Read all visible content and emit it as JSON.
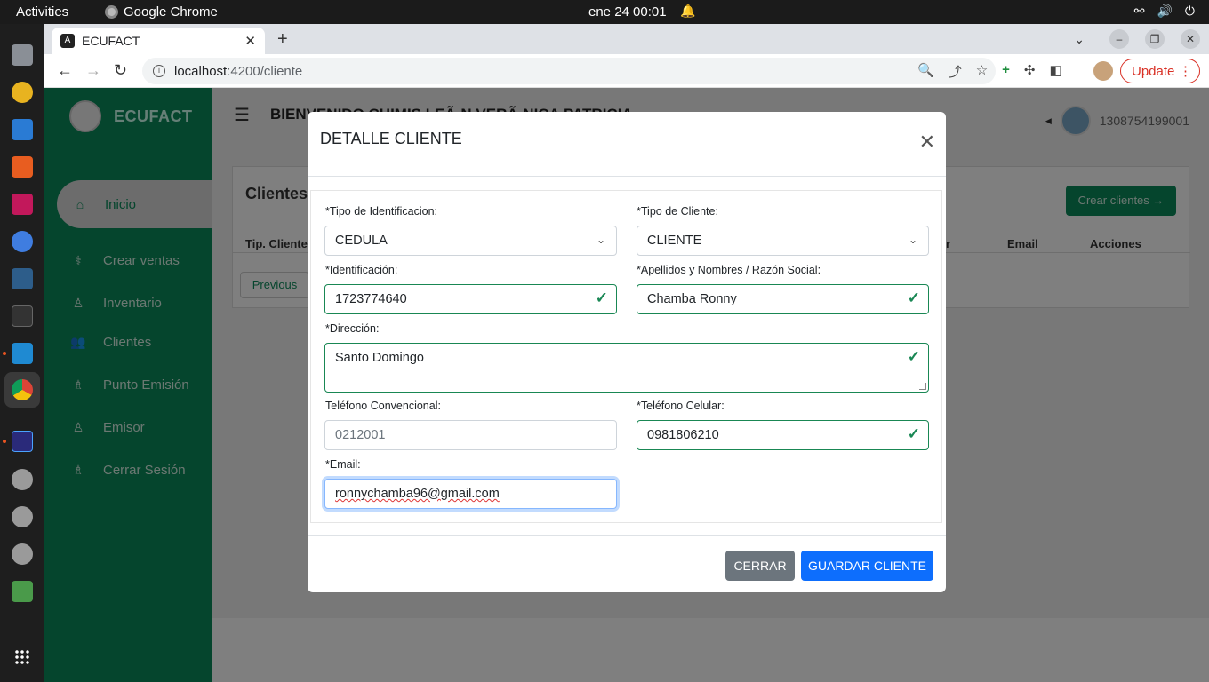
{
  "os": {
    "activities": "Activities",
    "app_name": "Google Chrome",
    "clock": "ene 24  00:01"
  },
  "browser": {
    "tab_title": "ECUFACT",
    "url_host": "localhost",
    "url_path": ":4200/cliente",
    "update_label": "Update"
  },
  "app": {
    "brand": "ECUFACT",
    "welcome": "BIENVENIDO CHIMIS LEÃ‹N VERÃ‹NICA PATRICIA",
    "user_id": "1308754199001",
    "nav": [
      {
        "label": "Inicio"
      },
      {
        "label": "Crear ventas"
      },
      {
        "label": "Inventario"
      },
      {
        "label": "Clientes"
      },
      {
        "label": "Punto Emisión"
      },
      {
        "label": "Emisor"
      },
      {
        "label": "Cerrar Sesión"
      }
    ],
    "card_title": "Clientes",
    "create_button": "Crear clientes →",
    "table_headers": {
      "tipo": "Tip. Cliente",
      "partial": "r",
      "email": "Email",
      "acciones": "Acciones"
    },
    "previous": "Previous"
  },
  "modal": {
    "title": "DETALLE CLIENTE",
    "tipo_id_label": "*Tipo de Identificacion:",
    "tipo_id_value": "CEDULA",
    "tipo_cliente_label": "*Tipo de Cliente:",
    "tipo_cliente_value": "CLIENTE",
    "identificacion_label": "*Identificación:",
    "identificacion_value": "1723774640",
    "nombres_label": "*Apellidos y Nombres / Razón Social:",
    "nombres_value": "Chamba Ronny",
    "direccion_label": "*Dirección:",
    "direccion_value": "Santo Domingo",
    "telefono_conv_label": "Teléfono Convencional:",
    "telefono_conv_value": "0212001",
    "telefono_cel_label": "*Teléfono Celular:",
    "telefono_cel_value": "0981806210",
    "email_label": "*Email:",
    "email_value": "ronnychamba96@gmail.com",
    "cerrar": "CERRAR",
    "guardar": "GUARDAR CLIENTE"
  }
}
